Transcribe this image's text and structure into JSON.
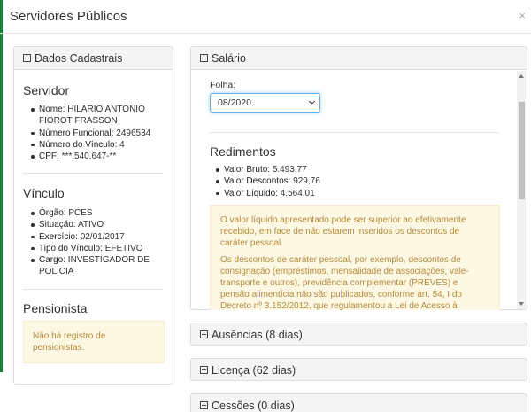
{
  "modal": {
    "title": "Servidores Públicos",
    "close": "×"
  },
  "dados": {
    "heading": "Dados Cadastrais",
    "servidor": {
      "title": "Servidor",
      "items": [
        {
          "label": "Nome:",
          "value": "HILARIO ANTONIO FIOROT FRASSON"
        },
        {
          "label": "Número Funcional:",
          "value": "2496534"
        },
        {
          "label": "Número do Vínculo:",
          "value": "4"
        },
        {
          "label": "CPF:",
          "value": "***.540.647-**"
        }
      ]
    },
    "vinculo": {
      "title": "Vínculo",
      "items": [
        {
          "label": "Órgão:",
          "value": "PCES"
        },
        {
          "label": "Situação:",
          "value": "ATIVO"
        },
        {
          "label": "Exercício:",
          "value": "02/01/2017"
        },
        {
          "label": "Tipo do Vínculo:",
          "value": "EFETIVO"
        },
        {
          "label": "Cargo:",
          "value": "INVESTIGADOR DE POLICIA"
        }
      ]
    },
    "pensionista": {
      "title": "Pensionista",
      "message": "Não há registro de pensionistas."
    }
  },
  "salario": {
    "heading": "Salário",
    "folha_label": "Folha:",
    "folha_selected": "08/2020",
    "redimentos_title": "Redimentos",
    "items": [
      {
        "label": "Valor Bruto:",
        "value": "5.493,77"
      },
      {
        "label": "Valor Descontos:",
        "value": "929,76"
      },
      {
        "label": "Valor Líquido:",
        "value": "4.564,01"
      }
    ],
    "note1": "O valor líquido apresentado pode ser superior ao efetivamente recebido, em face de não estarem inseridos os descontos de caráter pessoal.",
    "note2": "Os descontos de caráter pessoal, por exemplo, descontos de consignação (empréstimos, mensalidade de associações, vale-transporte e outros), previdência complementar (PREVES) e pensão alimentícia não são publicados, conforme art. 54, I do Decreto nº 3.152/2012, que regulamentou a Lei de Acesso à Informação no"
  },
  "collapsed": [
    {
      "label": "Ausências (8 dias)"
    },
    {
      "label": "Licença (62 dias)"
    },
    {
      "label": "Cessões (0 dias)"
    }
  ]
}
